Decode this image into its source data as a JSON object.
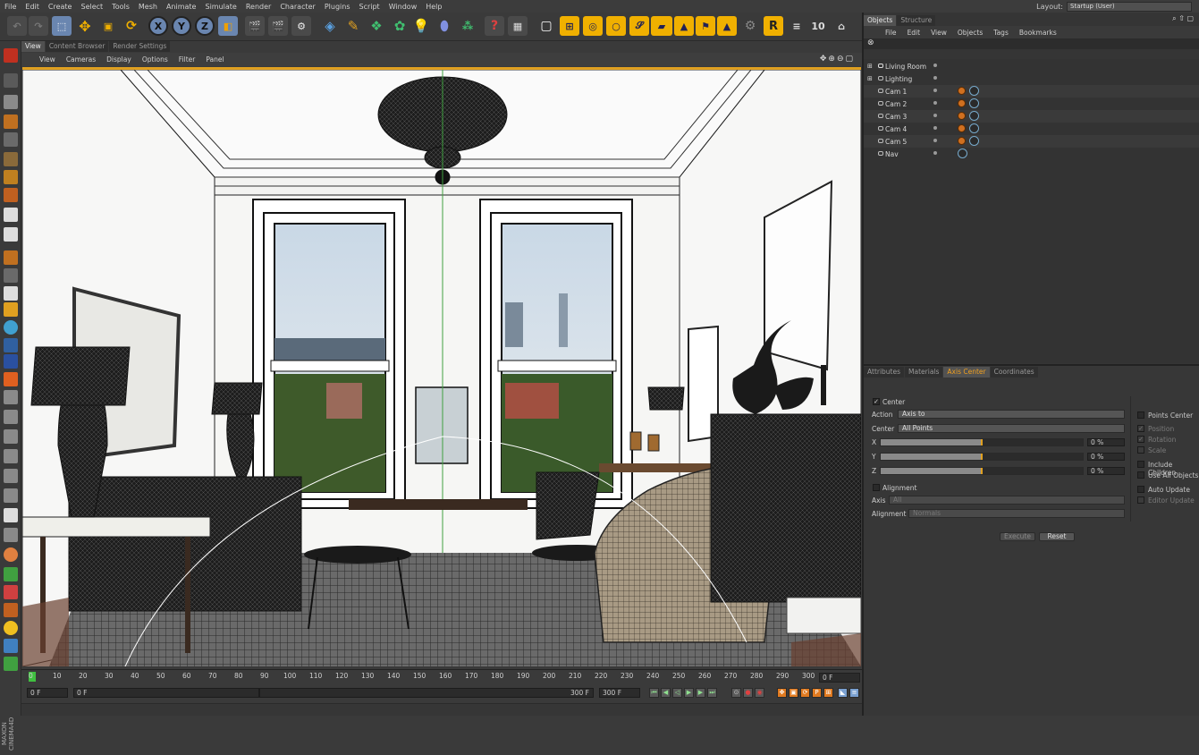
{
  "menubar": {
    "items": [
      "File",
      "Edit",
      "Create",
      "Select",
      "Tools",
      "Mesh",
      "Animate",
      "Simulate",
      "Render",
      "Character",
      "Plugins",
      "Script",
      "Window",
      "Help"
    ],
    "layout_label": "Layout:",
    "layout_value": "Startup (User)"
  },
  "toolbar": {
    "axis_x": "X",
    "axis_y": "Y",
    "axis_z": "Z"
  },
  "viewport": {
    "tabs": [
      "View",
      "Content Browser",
      "Render Settings"
    ],
    "menu": [
      "View",
      "Cameras",
      "Display",
      "Options",
      "Filter",
      "Panel"
    ],
    "nav_icons": "✥⊕⊖▢"
  },
  "timeline": {
    "ticks": [
      "0",
      "10",
      "20",
      "30",
      "40",
      "50",
      "60",
      "70",
      "80",
      "90",
      "100",
      "110",
      "120",
      "130",
      "140",
      "150",
      "160",
      "170",
      "180",
      "190",
      "200",
      "210",
      "220",
      "230",
      "240",
      "250",
      "260",
      "270",
      "280",
      "290",
      "300"
    ],
    "current_frame": "0 F",
    "start_field": "0 F",
    "range_start": "0 F",
    "range_end": "300 F",
    "end_field": "300 F"
  },
  "brand": "MAXON CINEMA4D",
  "objects_panel": {
    "tabs": [
      "Objects",
      "Structure"
    ],
    "menu": [
      "File",
      "Edit",
      "View",
      "Objects",
      "Tags",
      "Bookmarks"
    ],
    "items": [
      {
        "name": "Living Room",
        "tags": false
      },
      {
        "name": "Lighting",
        "tags": false
      },
      {
        "name": "Cam 1",
        "tags": true
      },
      {
        "name": "Cam 2",
        "tags": true
      },
      {
        "name": "Cam 3",
        "tags": true
      },
      {
        "name": "Cam 4",
        "tags": true
      },
      {
        "name": "Cam 5",
        "tags": true
      },
      {
        "name": "Nav",
        "tags": true
      }
    ]
  },
  "attributes_panel": {
    "tabs": [
      "Attributes",
      "Materials",
      "Axis Center",
      "Coordinates"
    ],
    "center_label": "Center",
    "action_label": "Action",
    "action_value": "Axis to",
    "center_field_label": "Center",
    "center_value": "All Points",
    "x_label": "X",
    "y_label": "Y",
    "z_label": "Z",
    "x_value": "0 %",
    "y_value": "0 %",
    "z_value": "0 %",
    "alignment_check_label": "Alignment",
    "axis_label": "Axis",
    "axis_value": "All",
    "alignment_label": "Alignment",
    "alignment_value": "Normals",
    "right_options": {
      "points_center": "Points Center",
      "position": "Position",
      "rotation": "Rotation",
      "scale": "Scale",
      "include_children": "Include Children",
      "use_all_objects": "Use All Objects",
      "auto_update": "Auto Update",
      "editor_update": "Editor Update"
    },
    "execute": "Execute",
    "reset": "Reset"
  },
  "colors": {
    "accent": "#e0a020",
    "panel": "#353535",
    "viewport_bg": "#f4f4f2"
  }
}
